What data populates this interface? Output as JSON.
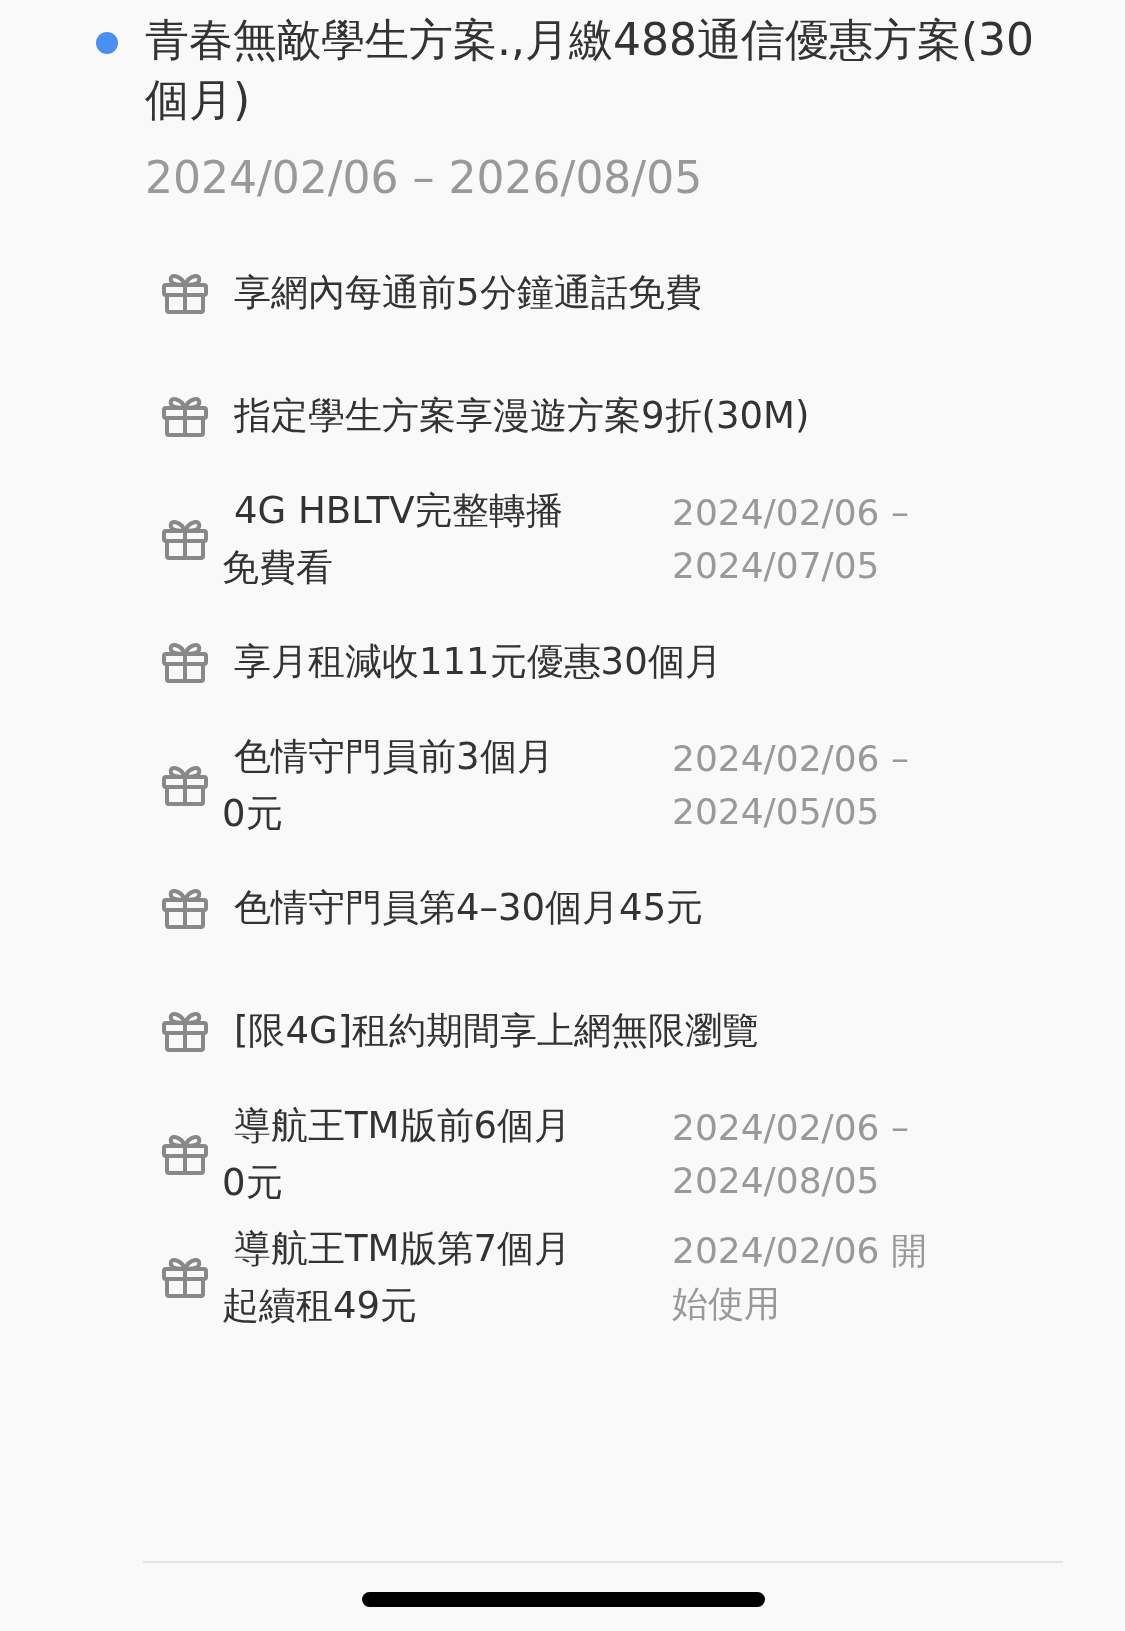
{
  "plan": {
    "title": "青春無敵學生方案.,月繳488通信優惠方案(30個月)",
    "period": "2024/02/06 – 2026/08/05"
  },
  "benefits": [
    {
      "text": "享網內每通前5分鐘通話免費"
    },
    {
      "text": "指定學生方案享漫遊方案9折(30M)"
    },
    {
      "text": "4G HBLTV完整轉播免費看",
      "period": "2024/02/06 – 2024/07/05"
    },
    {
      "text": "享月租減收111元優惠30個月"
    },
    {
      "text": "色情守門員前3個月0元",
      "period": "2024/02/06 – 2024/05/05"
    },
    {
      "text": "色情守門員第4–30個月45元"
    },
    {
      "text": "[限4G]租約期間享上網無限瀏覽"
    },
    {
      "text": "導航王TM版前6個月0元",
      "period": "2024/02/06 – 2024/08/05"
    },
    {
      "text": "導航王TM版第7個月起續租49元",
      "period": "2024/02/06 開始使用"
    }
  ]
}
